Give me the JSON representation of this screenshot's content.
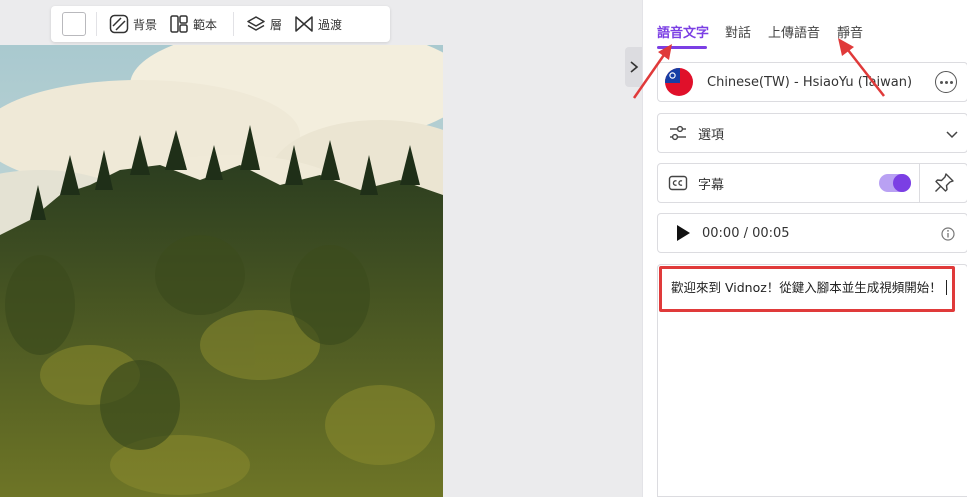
{
  "toolbar": {
    "background_label": "背景",
    "template_label": "範本",
    "layer_label": "層",
    "transition_label": "過渡"
  },
  "tabs": [
    {
      "label": "語音文字",
      "active": true
    },
    {
      "label": "對話",
      "active": false
    },
    {
      "label": "上傳語音",
      "active": false
    },
    {
      "label": "靜音",
      "active": false
    }
  ],
  "voice": {
    "name": "Chinese(TW) - HsiaoYu (Taiwan)",
    "flag": "taiwan-flag-icon"
  },
  "options": {
    "label": "選項"
  },
  "subtitles": {
    "label": "字幕",
    "enabled": true
  },
  "player": {
    "time": "00:00 / 00:05"
  },
  "script": {
    "text": "歡迎來到 Vidnoz！從鍵入腳本並生成視頻開始！"
  },
  "colors": {
    "accent": "#7b3fe4",
    "highlight": "#e03a3a",
    "toggle_track": "#b9a1f3"
  }
}
